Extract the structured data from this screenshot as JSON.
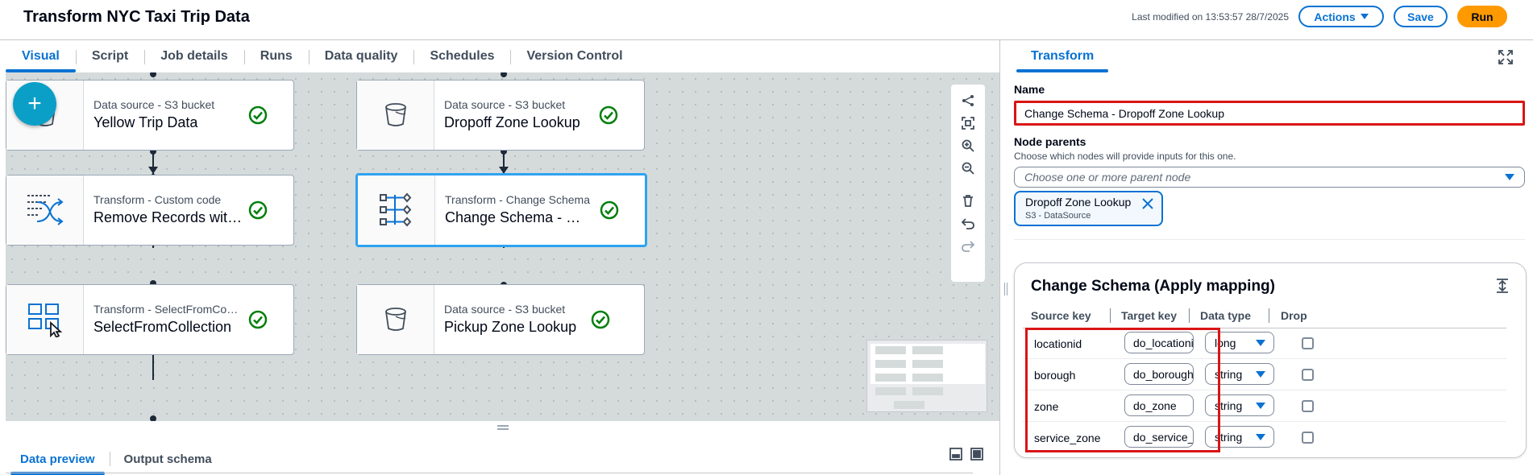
{
  "header": {
    "title": "Transform NYC Taxi Trip Data",
    "last_modified": "Last modified on 13:53:57 28/7/2025",
    "actions_label": "Actions",
    "save_label": "Save",
    "run_label": "Run"
  },
  "tabs": [
    "Visual",
    "Script",
    "Job details",
    "Runs",
    "Data quality",
    "Schedules",
    "Version Control"
  ],
  "active_tab": "Visual",
  "canvas": {
    "add_button_label": "+",
    "nodes": [
      {
        "type": "Data source - S3 bucket",
        "name": "Yellow Trip Data",
        "icon": "s3-bucket-icon",
        "status": "success"
      },
      {
        "type": "Data source - S3 bucket",
        "name": "Dropoff Zone Lookup",
        "icon": "s3-bucket-icon",
        "status": "success"
      },
      {
        "type": "Transform - Custom code",
        "name": "Remove Records with NULL",
        "icon": "custom-code-icon",
        "status": "success"
      },
      {
        "type": "Transform - Change Schema",
        "name": "Change Schema - Dropoff Zone Lookup",
        "icon": "change-schema-icon",
        "status": "success",
        "selected": true
      },
      {
        "type": "Transform - SelectFromCollection",
        "name": "SelectFromCollection",
        "icon": "select-from-collection-icon",
        "status": "success"
      },
      {
        "type": "Data source - S3 bucket",
        "name": "Pickup Zone Lookup",
        "icon": "s3-bucket-icon",
        "status": "success"
      }
    ],
    "toolbar_icons": [
      "layout-icon",
      "fit-view-icon",
      "zoom-in-icon",
      "zoom-out-icon",
      "delete-icon",
      "undo-icon",
      "redo-icon"
    ]
  },
  "bottom_panel": {
    "tabs": [
      "Data preview",
      "Output schema"
    ],
    "active_tab": "Data preview"
  },
  "right_panel": {
    "tab": "Transform",
    "name_label": "Name",
    "name_value": "Change Schema - Dropoff Zone Lookup",
    "parents_label": "Node parents",
    "parents_desc": "Choose which nodes will provide inputs for this one.",
    "parents_placeholder": "Choose one or more parent node",
    "selected_parent": {
      "title": "Dropoff Zone Lookup",
      "subtitle": "S3 - DataSource"
    },
    "mapping": {
      "title": "Change Schema (Apply mapping)",
      "columns": [
        "Source key",
        "Target key",
        "Data type",
        "Drop"
      ],
      "rows": [
        {
          "source": "locationid",
          "target": "do_locationid",
          "type": "long",
          "drop": false
        },
        {
          "source": "borough",
          "target": "do_borough",
          "type": "string",
          "drop": false
        },
        {
          "source": "zone",
          "target": "do_zone",
          "type": "string",
          "drop": false
        },
        {
          "source": "service_zone",
          "target": "do_service_zone",
          "type": "string",
          "drop": false
        }
      ]
    }
  },
  "colors": {
    "accent": "#0972d3",
    "run_button": "#ff9900",
    "success": "#037f0c",
    "highlight": "#d91515",
    "fab": "#0b9fc7"
  }
}
